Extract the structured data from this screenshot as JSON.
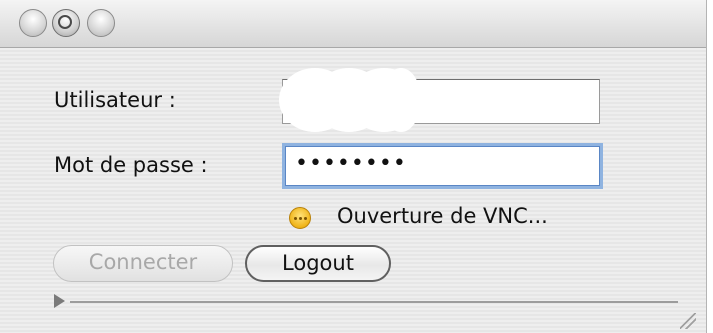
{
  "window": {
    "title": ""
  },
  "form": {
    "user_label": "Utilisateur :",
    "user_value": "",
    "password_label": "Mot de passe :",
    "password_value": "••••••••"
  },
  "status": {
    "text": "Ouverture de VNC...",
    "icon": "pending-icon",
    "icon_color": "#f0b418"
  },
  "buttons": {
    "connect_label": "Connecter",
    "logout_label": "Logout"
  },
  "progress": {
    "expanded": false,
    "percent": 0
  }
}
